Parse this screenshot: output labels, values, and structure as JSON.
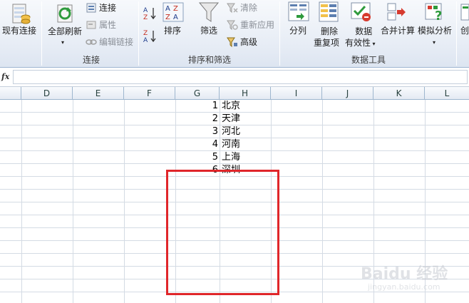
{
  "ribbon": {
    "buttons": {
      "existing_connections": "现有连接",
      "refresh_all": "全部刷新",
      "connections": "连接",
      "properties": "属性",
      "edit_links": "编辑链接",
      "sort": "排序",
      "filter": "筛选",
      "clear": "清除",
      "reapply": "重新应用",
      "advanced": "高级",
      "text_to_columns": "分列",
      "remove_duplicates_line1": "删除",
      "remove_duplicates_line2": "重复项",
      "data_validation_line1": "数据",
      "data_validation_line2": "有效性",
      "consolidate": "合并计算",
      "what_if_analysis": "模拟分析",
      "create_partial": "创"
    },
    "groups": {
      "connections": "连接",
      "sort_filter": "排序和筛选",
      "data_tools": "数据工具"
    }
  },
  "formula_bar": {
    "fx_label": "fx",
    "value": ""
  },
  "columns": [
    "D",
    "E",
    "F",
    "G",
    "H",
    "I",
    "J",
    "K",
    "L"
  ],
  "cells": [
    {
      "num": "1",
      "text": "北京"
    },
    {
      "num": "2",
      "text": "天津"
    },
    {
      "num": "3",
      "text": "河北"
    },
    {
      "num": "4",
      "text": "河南"
    },
    {
      "num": "5",
      "text": "上海"
    },
    {
      "num": "6",
      "text": "深圳"
    }
  ],
  "watermark": {
    "main": "Baidu 经验",
    "url": "jingyan.baidu.com"
  },
  "colors": {
    "highlight": "#e0262a",
    "grid": "#d4dbe4",
    "header": "#e4eaf3"
  }
}
